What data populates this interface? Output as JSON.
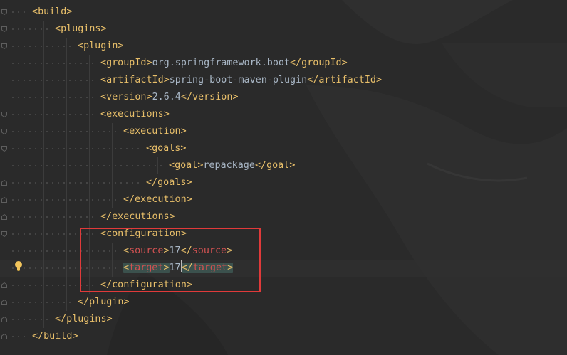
{
  "editor": {
    "language": "xml",
    "lines": [
      {
        "indent": 0,
        "open": true,
        "tag": "build"
      },
      {
        "indent": 1,
        "open": true,
        "tag": "plugins"
      },
      {
        "indent": 2,
        "open": true,
        "tag": "plugin"
      },
      {
        "indent": 3,
        "tag": "groupId",
        "value": "org.springframework.boot"
      },
      {
        "indent": 3,
        "tag": "artifactId",
        "value": "spring-boot-maven-plugin"
      },
      {
        "indent": 3,
        "tag": "version",
        "value": "2.6.4"
      },
      {
        "indent": 3,
        "open": true,
        "tag": "executions"
      },
      {
        "indent": 4,
        "open": true,
        "tag": "execution"
      },
      {
        "indent": 5,
        "open": true,
        "tag": "goals"
      },
      {
        "indent": 6,
        "tag": "goal",
        "value": "repackage"
      },
      {
        "indent": 5,
        "close": true,
        "tag": "goals"
      },
      {
        "indent": 4,
        "close": true,
        "tag": "execution"
      },
      {
        "indent": 3,
        "close": true,
        "tag": "executions"
      },
      {
        "indent": 3,
        "open": true,
        "tag": "configuration"
      },
      {
        "indent": 4,
        "tag": "source",
        "value": "17",
        "error": true
      },
      {
        "indent": 4,
        "tag": "target",
        "value": "17",
        "error": true,
        "current": true
      },
      {
        "indent": 3,
        "close": true,
        "tag": "configuration"
      },
      {
        "indent": 2,
        "close": true,
        "tag": "plugin"
      },
      {
        "indent": 1,
        "close": true,
        "tag": "plugins"
      },
      {
        "indent": 0,
        "close": true,
        "tag": "build"
      }
    ]
  },
  "icons": {
    "fold": "fold-marker-icon",
    "bulb": "intention-bulb-icon"
  },
  "colors": {
    "tag": "#e8bf6a",
    "error_tag": "#d25252",
    "text": "#a9b7c6",
    "highlight_box": "#e03a3a",
    "bulb": "#f2c55c"
  }
}
